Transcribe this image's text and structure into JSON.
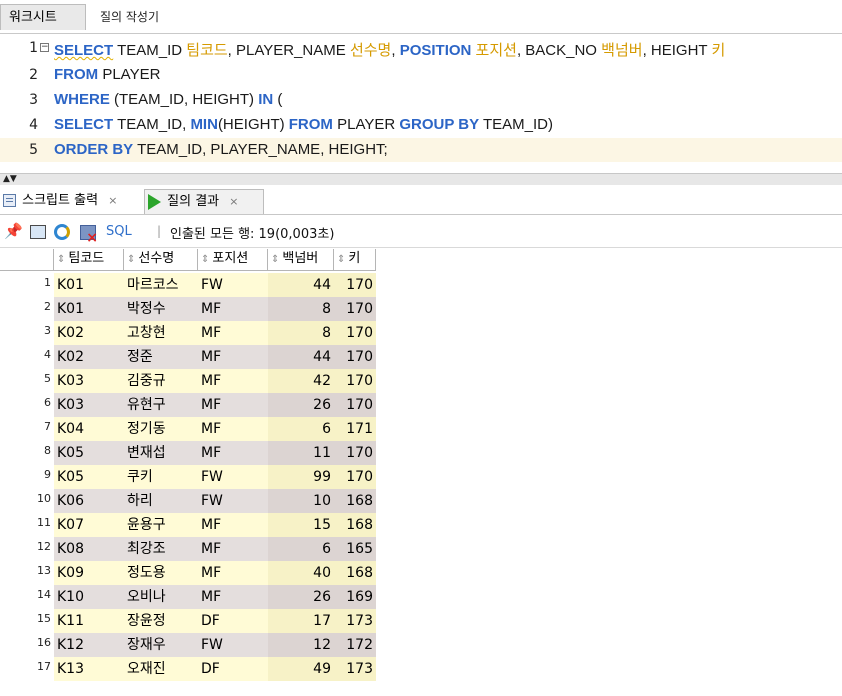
{
  "tabs": {
    "worksheet": "워크시트",
    "query_builder": "질의 작성기"
  },
  "editor": {
    "lines": [
      {
        "num": "1",
        "tokens": [
          {
            "t": "SELECT",
            "c": "kw wavy"
          },
          {
            "t": " TEAM_ID ",
            "c": ""
          },
          {
            "t": "팀코드",
            "c": "kr"
          },
          {
            "t": ", PLAYER_NAME ",
            "c": ""
          },
          {
            "t": "선수명",
            "c": "kr"
          },
          {
            "t": ", ",
            "c": ""
          },
          {
            "t": "POSITION",
            "c": "kw"
          },
          {
            "t": " ",
            "c": ""
          },
          {
            "t": "포지션",
            "c": "kr"
          },
          {
            "t": ", BACK_NO ",
            "c": ""
          },
          {
            "t": "백넘버",
            "c": "kr"
          },
          {
            "t": ", HEIGHT ",
            "c": ""
          },
          {
            "t": "키",
            "c": "kr"
          }
        ]
      },
      {
        "num": "2",
        "tokens": [
          {
            "t": "FROM",
            "c": "kw"
          },
          {
            "t": " PLAYER",
            "c": ""
          }
        ]
      },
      {
        "num": "3",
        "tokens": [
          {
            "t": "WHERE",
            "c": "kw"
          },
          {
            "t": " (TEAM_ID, HEIGHT) ",
            "c": ""
          },
          {
            "t": "IN",
            "c": "kw"
          },
          {
            "t": " (",
            "c": ""
          }
        ]
      },
      {
        "num": "4",
        "tokens": [
          {
            "t": "SELECT",
            "c": "kw"
          },
          {
            "t": " TEAM_ID, ",
            "c": ""
          },
          {
            "t": "MIN",
            "c": "kw"
          },
          {
            "t": "(HEIGHT) ",
            "c": ""
          },
          {
            "t": "FROM",
            "c": "kw"
          },
          {
            "t": " PLAYER ",
            "c": ""
          },
          {
            "t": "GROUP BY",
            "c": "kw"
          },
          {
            "t": " TEAM_ID)",
            "c": ""
          }
        ]
      },
      {
        "num": "5",
        "tokens": [
          {
            "t": "ORDER BY",
            "c": "kw"
          },
          {
            "t": " TEAM_ID, PLAYER_NAME, HEIGHT;",
            "c": ""
          }
        ]
      }
    ]
  },
  "result_tabs": {
    "script_output": "스크립트 출력",
    "query_result": "질의 결과",
    "close": "×"
  },
  "toolbar": {
    "sql": "SQL",
    "separator": "|",
    "status": "인출된 모든 행: 19(0,003초)"
  },
  "grid": {
    "headers": [
      "팀코드",
      "선수명",
      "포지션",
      "백넘버",
      "키"
    ],
    "sort_glyph": "⇕",
    "rows": [
      {
        "n": "1",
        "team": "K01",
        "name": "마르코스",
        "pos": "FW",
        "back": "44",
        "ht": "170"
      },
      {
        "n": "2",
        "team": "K01",
        "name": "박정수",
        "pos": "MF",
        "back": "8",
        "ht": "170"
      },
      {
        "n": "3",
        "team": "K02",
        "name": "고창현",
        "pos": "MF",
        "back": "8",
        "ht": "170"
      },
      {
        "n": "4",
        "team": "K02",
        "name": "정준",
        "pos": "MF",
        "back": "44",
        "ht": "170"
      },
      {
        "n": "5",
        "team": "K03",
        "name": "김중규",
        "pos": "MF",
        "back": "42",
        "ht": "170"
      },
      {
        "n": "6",
        "team": "K03",
        "name": "유현구",
        "pos": "MF",
        "back": "26",
        "ht": "170"
      },
      {
        "n": "7",
        "team": "K04",
        "name": "정기동",
        "pos": "MF",
        "back": "6",
        "ht": "171"
      },
      {
        "n": "8",
        "team": "K05",
        "name": "변재섭",
        "pos": "MF",
        "back": "11",
        "ht": "170"
      },
      {
        "n": "9",
        "team": "K05",
        "name": "쿠키",
        "pos": "FW",
        "back": "99",
        "ht": "170"
      },
      {
        "n": "10",
        "team": "K06",
        "name": "하리",
        "pos": "FW",
        "back": "10",
        "ht": "168"
      },
      {
        "n": "11",
        "team": "K07",
        "name": "윤용구",
        "pos": "MF",
        "back": "15",
        "ht": "168"
      },
      {
        "n": "12",
        "team": "K08",
        "name": "최강조",
        "pos": "MF",
        "back": "6",
        "ht": "165"
      },
      {
        "n": "13",
        "team": "K09",
        "name": "정도용",
        "pos": "MF",
        "back": "40",
        "ht": "168"
      },
      {
        "n": "14",
        "team": "K10",
        "name": "오비나",
        "pos": "MF",
        "back": "26",
        "ht": "169"
      },
      {
        "n": "15",
        "team": "K11",
        "name": "장윤정",
        "pos": "DF",
        "back": "17",
        "ht": "173"
      },
      {
        "n": "16",
        "team": "K12",
        "name": "장재우",
        "pos": "FW",
        "back": "12",
        "ht": "172"
      },
      {
        "n": "17",
        "team": "K13",
        "name": "오재진",
        "pos": "DF",
        "back": "49",
        "ht": "173"
      }
    ]
  },
  "colors": {
    "keyword": "#2c65c6",
    "korean_alias": "#d59a00",
    "row_odd": "#fffbd6",
    "row_even": "#e4dedd"
  }
}
